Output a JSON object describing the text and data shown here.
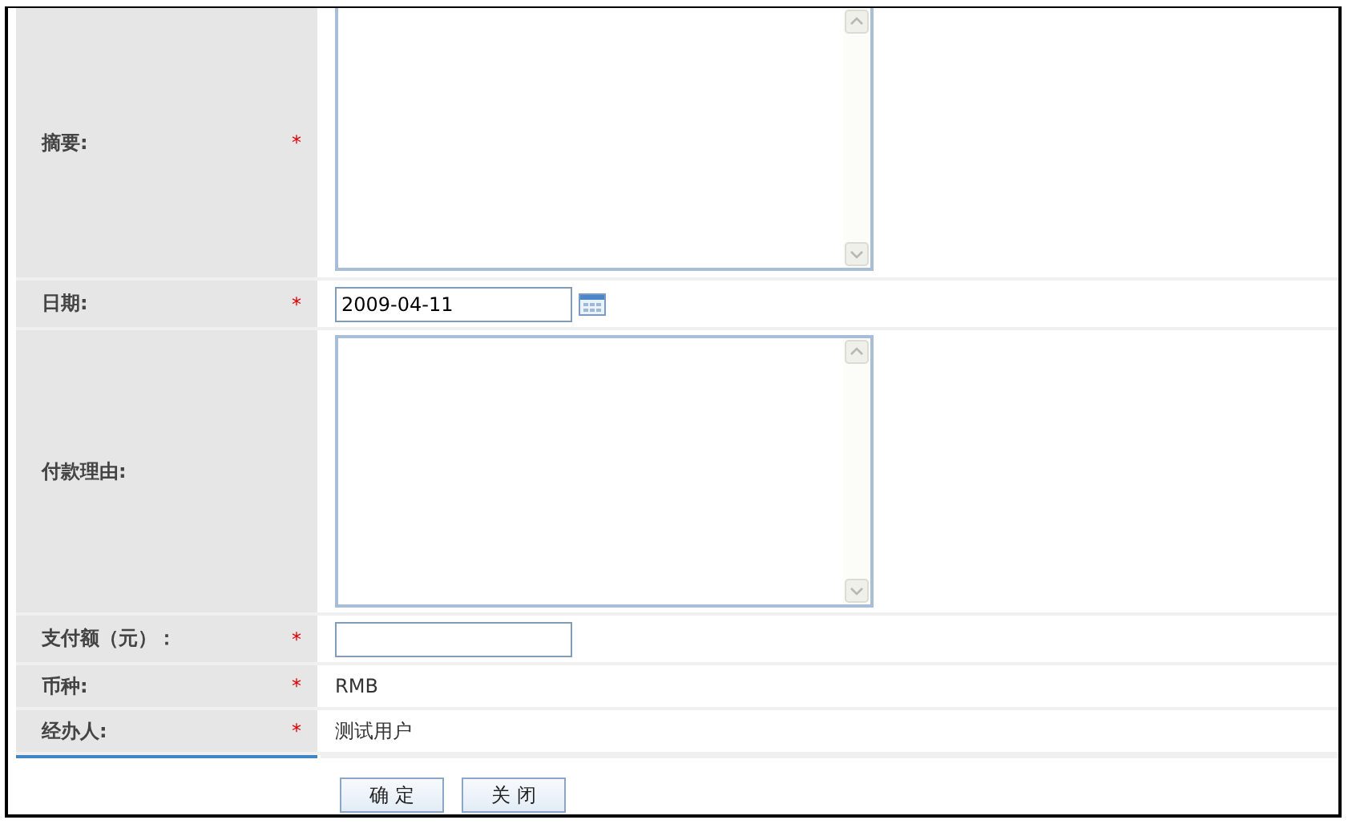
{
  "rows": [
    {
      "kind": "textarea",
      "label": "摘要:",
      "required_mark": "*"
    },
    {
      "kind": "date",
      "label": "日期:",
      "required_mark": "*",
      "value": "2009-04-11"
    },
    {
      "kind": "textarea",
      "label": "付款理由:"
    },
    {
      "kind": "input",
      "label": "支付额（元）：",
      "required_mark": "*"
    },
    {
      "kind": "static",
      "label": "币种:",
      "required_mark": "*",
      "value": "RMB"
    },
    {
      "kind": "static",
      "label": "经办人:",
      "required_mark": "*",
      "value": "测试用户"
    }
  ],
  "buttons": [
    "确 定",
    "关 闭"
  ]
}
